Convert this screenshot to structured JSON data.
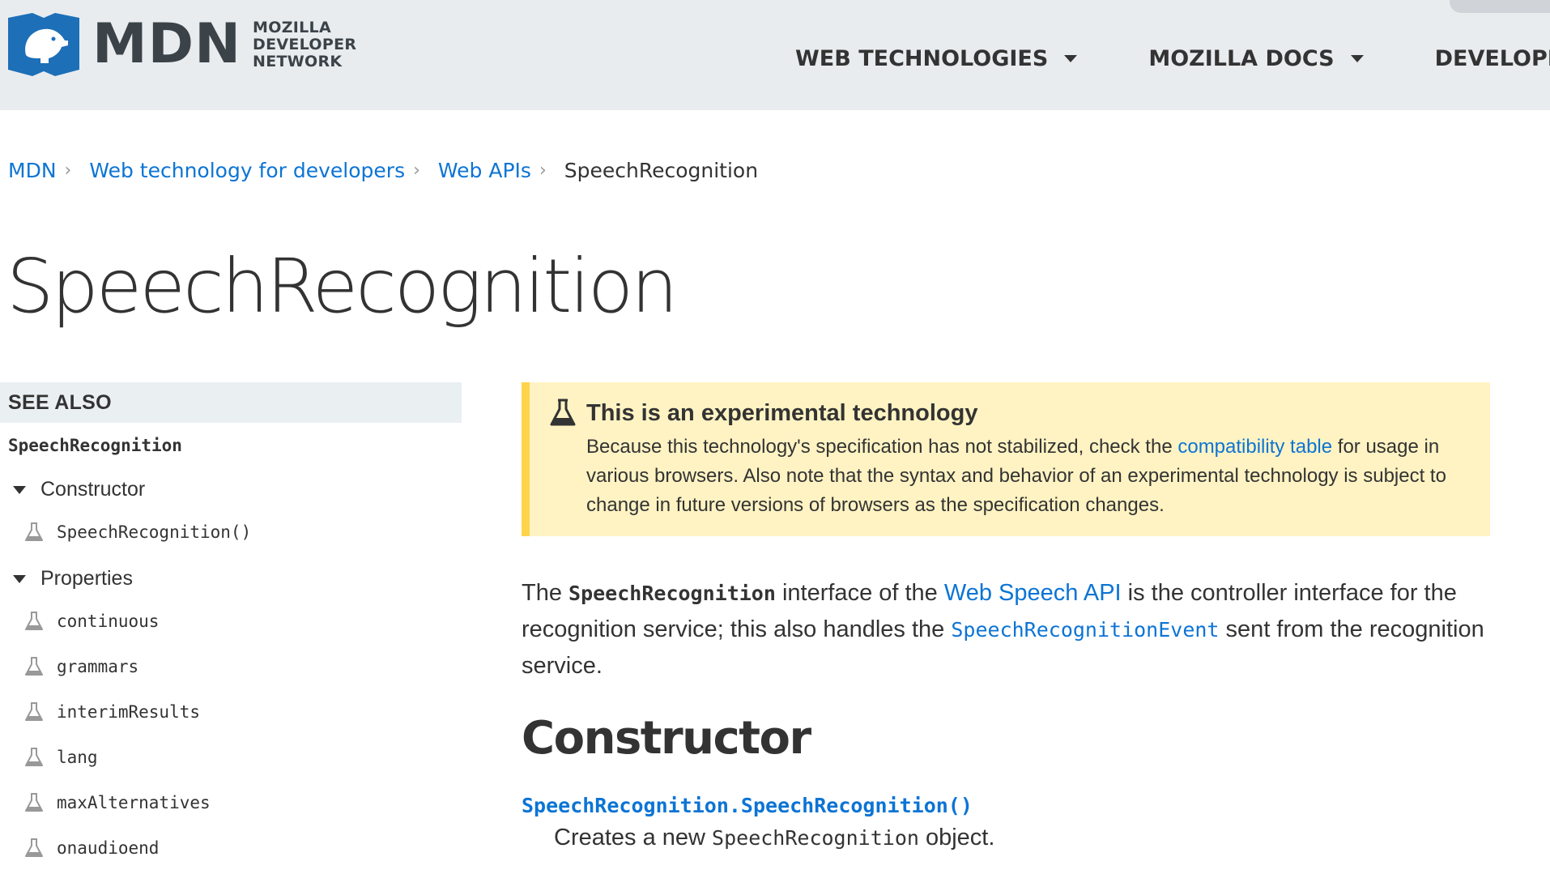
{
  "header": {
    "logo": {
      "brand": "MDN",
      "lines": [
        "MOZILLA",
        "DEVELOPER",
        "NETWORK"
      ]
    },
    "nav": [
      {
        "label": "WEB TECHNOLOGIES"
      },
      {
        "label": "MOZILLA DOCS"
      },
      {
        "label": "DEVELOPER TO"
      }
    ]
  },
  "breadcrumb": {
    "items": [
      "MDN",
      "Web technology for developers",
      "Web APIs"
    ],
    "current": "SpeechRecognition"
  },
  "page": {
    "title": "SpeechRecognition"
  },
  "sidebar": {
    "heading": "SEE ALSO",
    "main": "SpeechRecognition",
    "groups": [
      {
        "label": "Constructor",
        "items": [
          "SpeechRecognition()"
        ]
      },
      {
        "label": "Properties",
        "items": [
          "continuous",
          "grammars",
          "interimResults",
          "lang",
          "maxAlternatives",
          "onaudioend"
        ]
      }
    ]
  },
  "notice": {
    "title": "This is an experimental technology",
    "body_before": "Because this technology's specification has not stabilized, check the ",
    "link": "compatibility table",
    "body_after": " for usage in various browsers. Also note that the syntax and behavior of an experimental technology is subject to change in future versions of browsers as the specification changes."
  },
  "intro": {
    "t1": "The ",
    "code1": "SpeechRecognition",
    "t2": " interface of the ",
    "link1": "Web Speech API",
    "t3": " is the controller interface for the recognition service; this also handles the ",
    "code_link": "SpeechRecognitionEvent",
    "t4": " sent from the recognition service."
  },
  "constructor_section": {
    "heading": "Constructor",
    "link": "SpeechRecognition.SpeechRecognition()",
    "desc_before": "Creates a new ",
    "desc_code": "SpeechRecognition",
    "desc_after": " object."
  },
  "colors": {
    "link": "#0c74d5",
    "header_bg": "#e9ecef",
    "notice_bg": "#fff3c3",
    "notice_border": "#ffd34a",
    "logo_blue": "#1d6fb8"
  },
  "icons": {
    "logo": "mdn-dino-logo-icon",
    "experimental": "flask-icon"
  }
}
